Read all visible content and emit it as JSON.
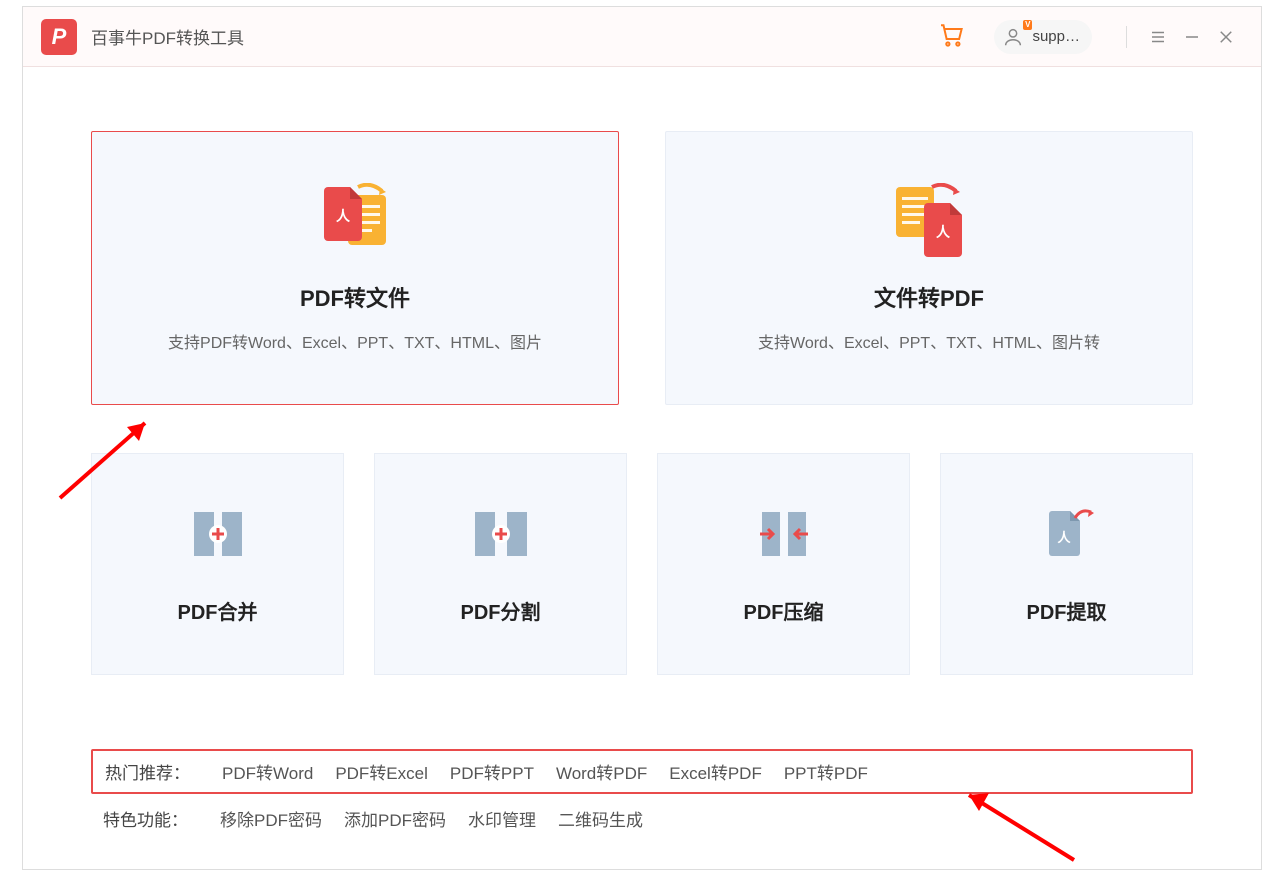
{
  "app": {
    "logo_letter": "P",
    "title": "百事牛PDF转换工具"
  },
  "header": {
    "user_label": "supp…",
    "vip_badge": "V"
  },
  "main_cards": [
    {
      "title": "PDF转文件",
      "desc": "支持PDF转Word、Excel、PPT、TXT、HTML、图片",
      "selected": true
    },
    {
      "title": "文件转PDF",
      "desc": "支持Word、Excel、PPT、TXT、HTML、图片转",
      "selected": false
    }
  ],
  "small_cards": [
    {
      "title": "PDF合并"
    },
    {
      "title": "PDF分割"
    },
    {
      "title": "PDF压缩"
    },
    {
      "title": "PDF提取"
    }
  ],
  "footer": {
    "hot_label": "热门推荐：",
    "hot_links": [
      "PDF转Word",
      "PDF转Excel",
      "PDF转PPT",
      "Word转PDF",
      "Excel转PDF",
      "PPT转PDF"
    ],
    "feature_label": "特色功能：",
    "feature_links": [
      "移除PDF密码",
      "添加PDF密码",
      "水印管理",
      "二维码生成"
    ]
  }
}
